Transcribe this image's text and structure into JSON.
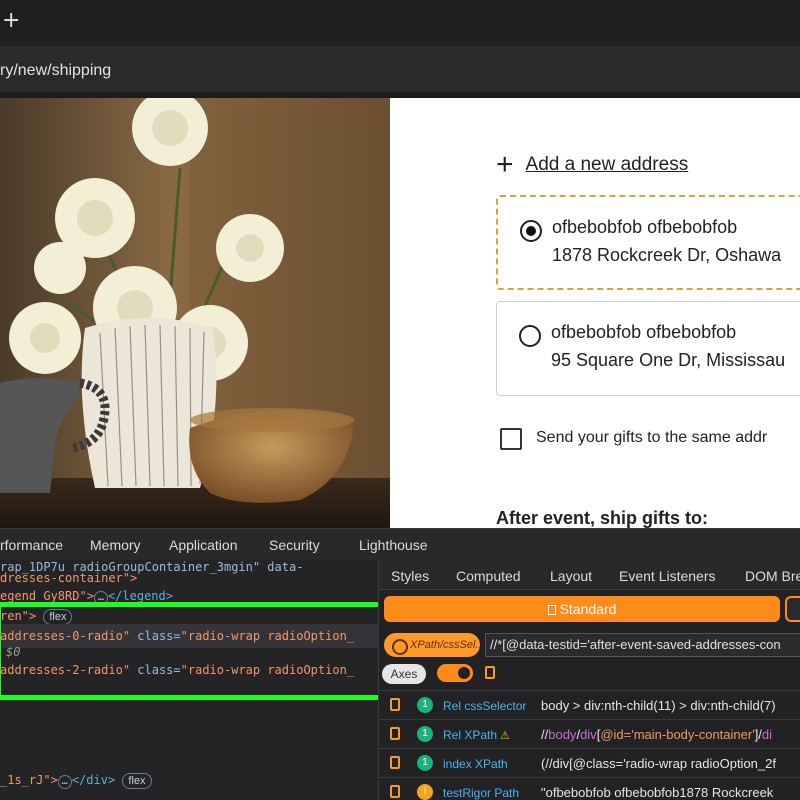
{
  "browser": {
    "new_tab_label": "+",
    "url_fragment": "ry/new/shipping"
  },
  "page": {
    "add_new_address": "Add a new address",
    "addresses": [
      {
        "name": "ofbebobfob ofbebobfob",
        "line": "1878 Rockcreek Dr, Oshawa",
        "selected": true
      },
      {
        "name": "ofbebobfob ofbebobfob",
        "line": "95 Square One Dr, Mississau",
        "selected": false
      }
    ],
    "same_address_label": "Send your gifts to the same addr",
    "after_event_heading": "After event, ship gifts to:"
  },
  "devtools": {
    "tabs": [
      "rformance",
      "Memory",
      "Application",
      "Security",
      "Lighthouse"
    ],
    "elements": {
      "lines": [
        {
          "t1": "rap_1DP7u radioGroupContainer_3mgin\" data-"
        },
        {
          "t1": "dresses-container\">"
        },
        {
          "t1": "egend_Gy8RD\">",
          "t2": "</legend>"
        },
        {
          "t1": "ren\">",
          "badge": "flex"
        },
        {
          "t1": "addresses-0-radio\"",
          "attr": "class=",
          "val": "\"radio-wrap radioOption_"
        },
        {
          "t1": "$0"
        },
        {
          "t1": "addresses-2-radio\"",
          "attr": "class=",
          "val": "\"radio-wrap radioOption_"
        },
        {
          "t1": "_1s_rJ\">",
          "t2": "</div>",
          "badge": "flex"
        }
      ],
      "dots_label": "…"
    },
    "sidebar": {
      "tabs": [
        "Styles",
        "Computed",
        "Layout",
        "Event Listeners",
        "DOM Bre"
      ],
      "standard_label": "Standard",
      "selector_pill": "XPath/cssSel..",
      "xpath_value": "//*[@data-testid='after-event-saved-addresses-con",
      "axes_label": "Axes",
      "results": [
        {
          "num": "1",
          "key": "Rel cssSelector",
          "value": "body > div:nth-child(11) > div:nth-child(7)",
          "warn": false
        },
        {
          "num": "1",
          "key": "Rel XPath",
          "value": "//body/div[@id='main-body-container']/di",
          "warn": false,
          "alert": "⚠"
        },
        {
          "num": "1",
          "key": "index XPath",
          "value": "(//div[@class='radio-wrap radioOption_2f",
          "warn": false
        },
        {
          "num": "i",
          "key": "testRigor Path",
          "value": "\"ofbebobfob ofbebobfob1878 Rockcreek",
          "warn": true
        }
      ]
    }
  },
  "colors": {
    "accent_orange": "#ff8c1a",
    "highlight_green": "#1bff1b",
    "selected_address_border": "#d4a63a"
  }
}
